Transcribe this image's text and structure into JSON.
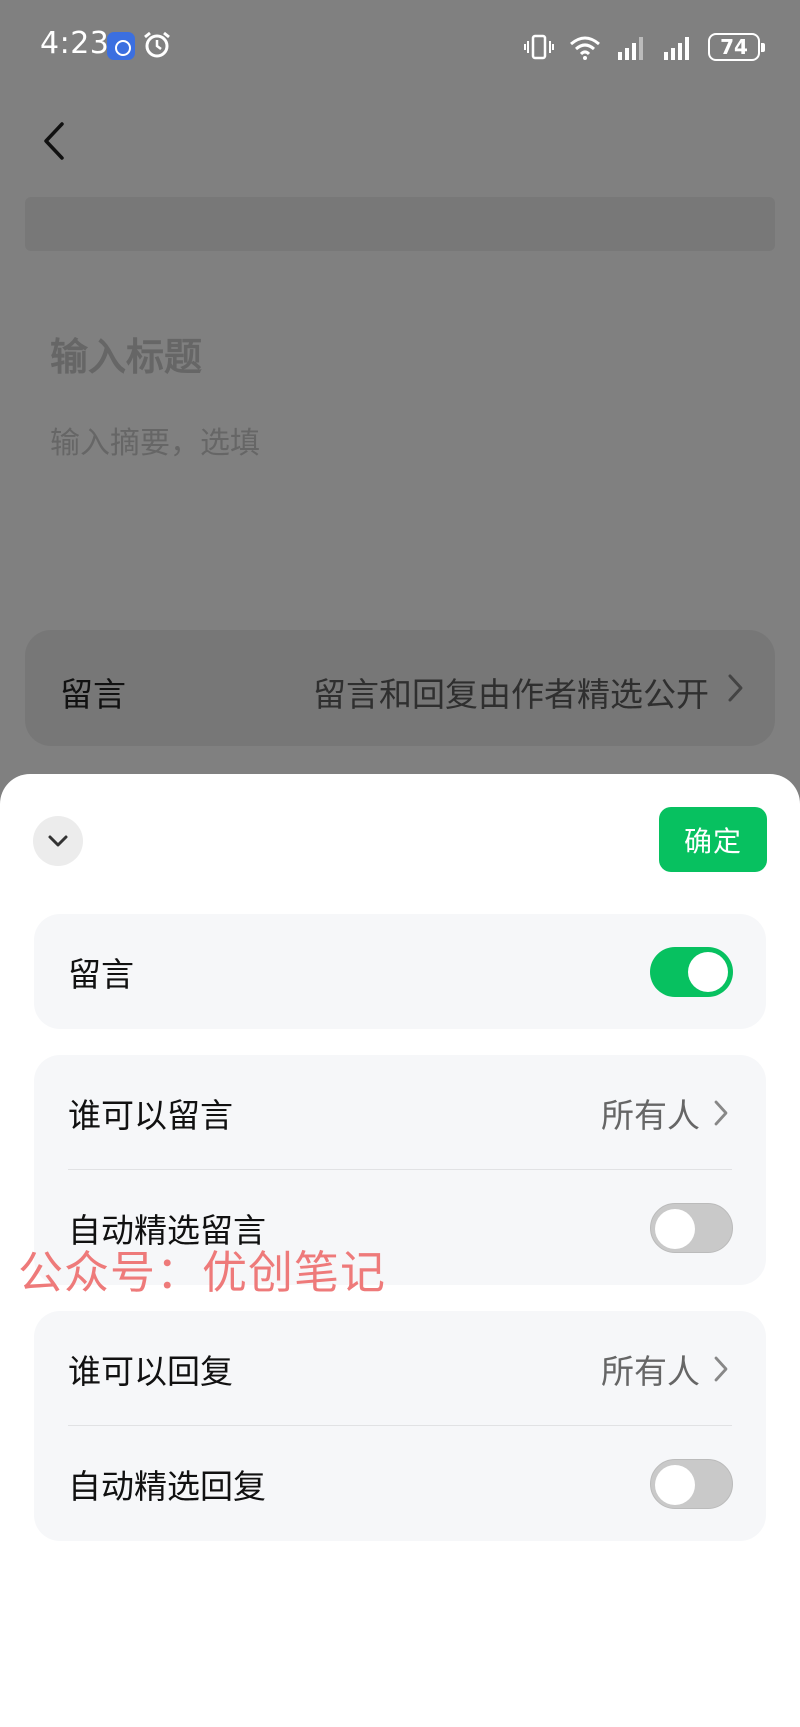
{
  "status_bar": {
    "time": "4:23",
    "battery": "74",
    "icons": [
      "app-icon",
      "alarm-icon",
      "vibrate-icon",
      "wifi-icon",
      "signal-icon",
      "signal-icon",
      "battery-icon"
    ]
  },
  "background_page": {
    "title_placeholder": "输入标题",
    "summary_placeholder": "输入摘要，选填",
    "comment_row": {
      "label": "留言",
      "value": "留言和回复由作者精选公开"
    }
  },
  "sheet": {
    "confirm_label": "确定",
    "comment_toggle": {
      "label": "留言",
      "on": true
    },
    "who_can_comment": {
      "label": "谁可以留言",
      "value": "所有人"
    },
    "auto_select_comments": {
      "label": "自动精选留言",
      "on": false
    },
    "who_can_reply": {
      "label": "谁可以回复",
      "value": "所有人"
    },
    "auto_select_replies": {
      "label": "自动精选回复",
      "on": false
    }
  },
  "watermark": "公众号：优创笔记",
  "colors": {
    "accent": "#07c160",
    "overlay": "#808080",
    "card": "#f6f7f9",
    "watermark": "#ee7a7a"
  }
}
